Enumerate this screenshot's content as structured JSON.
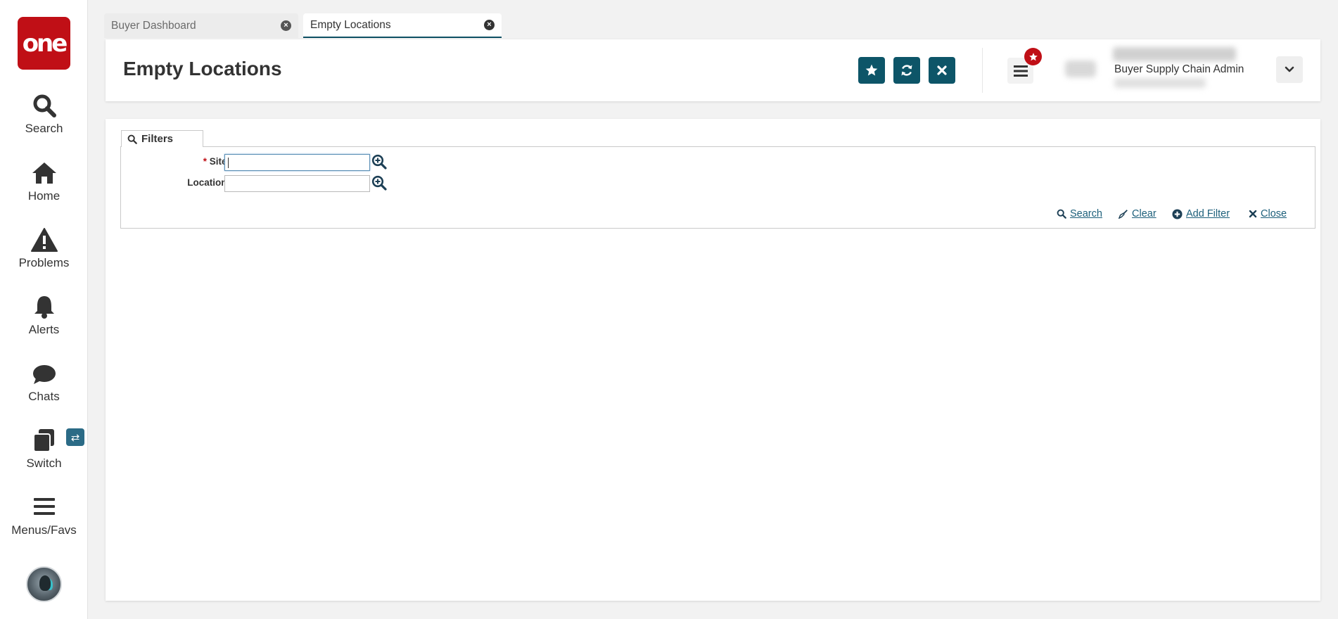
{
  "app": {
    "logo_text": "one",
    "brand_color": "#c00f16",
    "accent_color": "#0d5568"
  },
  "sidebar": {
    "items": [
      {
        "label": "Search",
        "icon": "search-icon"
      },
      {
        "label": "Home",
        "icon": "home-icon"
      },
      {
        "label": "Problems",
        "icon": "warning-icon"
      },
      {
        "label": "Alerts",
        "icon": "bell-icon"
      },
      {
        "label": "Chats",
        "icon": "chat-icon"
      },
      {
        "label": "Switch",
        "icon": "switch-icon"
      },
      {
        "label": "Menus/Favs",
        "icon": "hamburger-icon"
      }
    ],
    "switch_badge": "⇄"
  },
  "tabs": [
    {
      "label": "Buyer Dashboard",
      "active": false
    },
    {
      "label": "Empty Locations",
      "active": true
    }
  ],
  "header": {
    "title": "Empty Locations",
    "user_role": "Buyer Supply Chain Admin"
  },
  "filters": {
    "tab_label": "Filters",
    "fields": [
      {
        "label": "Site:",
        "required": true,
        "required_marker": "*",
        "value": ""
      },
      {
        "label": "Location:",
        "required": false,
        "value": ""
      }
    ],
    "actions": [
      {
        "label": "Search",
        "icon": "search-icon"
      },
      {
        "label": "Clear",
        "icon": "broom-icon"
      },
      {
        "label": "Add Filter",
        "icon": "plus-circle-icon"
      },
      {
        "label": "Close",
        "icon": "close-icon"
      }
    ]
  }
}
